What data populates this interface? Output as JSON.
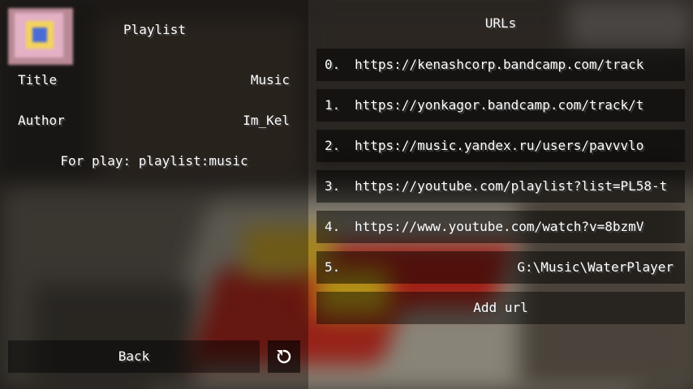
{
  "playlist": {
    "header": "Playlist",
    "title_label": "Title",
    "title_value": "Music",
    "author_label": "Author",
    "author_value": "Im_Kel",
    "play_hint": "For play: playlist:music",
    "thumbnail_icon": "playlist-cover-icon"
  },
  "urls": {
    "header": "URLs",
    "items": [
      {
        "index": "0.",
        "url": "https://kenashcorp.bandcamp.com/track"
      },
      {
        "index": "1.",
        "url": "https://yonkagor.bandcamp.com/track/t"
      },
      {
        "index": "2.",
        "url": "https://music.yandex.ru/users/pavvvlo"
      },
      {
        "index": "3.",
        "url": "https://youtube.com/playlist?list=PL58-t"
      },
      {
        "index": "4.",
        "url": "https://www.youtube.com/watch?v=8bzmV"
      },
      {
        "index": "5.",
        "url": "G:\\Music\\WaterPlayer"
      }
    ],
    "add_label": "Add url"
  },
  "footer": {
    "back_label": "Back",
    "reload_icon": "reload-icon"
  }
}
